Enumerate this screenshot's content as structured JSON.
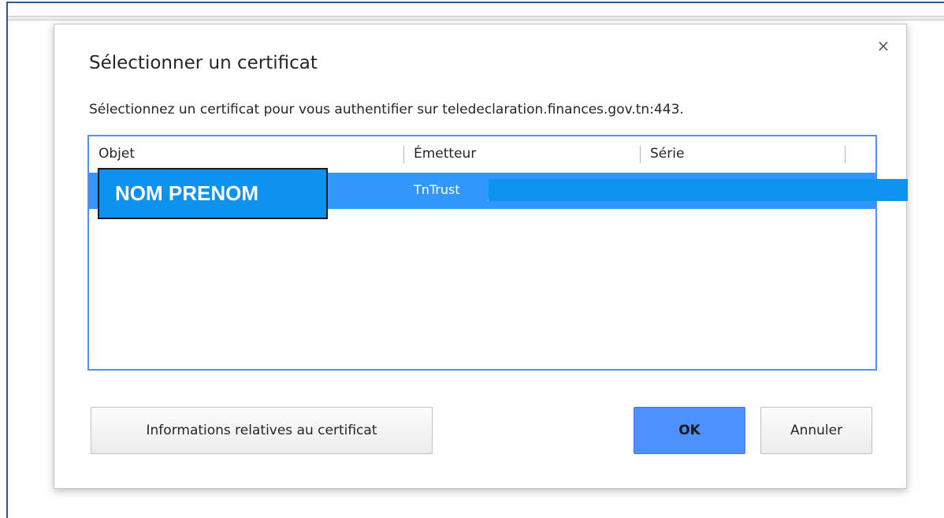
{
  "dialog": {
    "title": "Sélectionner un certificat",
    "description": "Sélectionnez un certificat pour vous authentifier sur teledeclaration.finances.gov.tn:443.",
    "close_icon": "close-icon",
    "close_glyph": "×"
  },
  "table": {
    "columns": [
      {
        "label": "Objet"
      },
      {
        "label": "Émetteur"
      },
      {
        "label": "Série"
      }
    ],
    "rows": [
      {
        "objet": "NOM PRENOM",
        "emetteur": "TnTrust",
        "serie": "",
        "extra": "_",
        "selected": true
      }
    ]
  },
  "buttons": {
    "info_label": "Informations relatives au certificat",
    "ok_label": "OK",
    "cancel_label": "Annuler"
  },
  "colors": {
    "selection": "#3297fd",
    "accent": "#4d90fe",
    "overlay_box": "#0d92f0"
  }
}
